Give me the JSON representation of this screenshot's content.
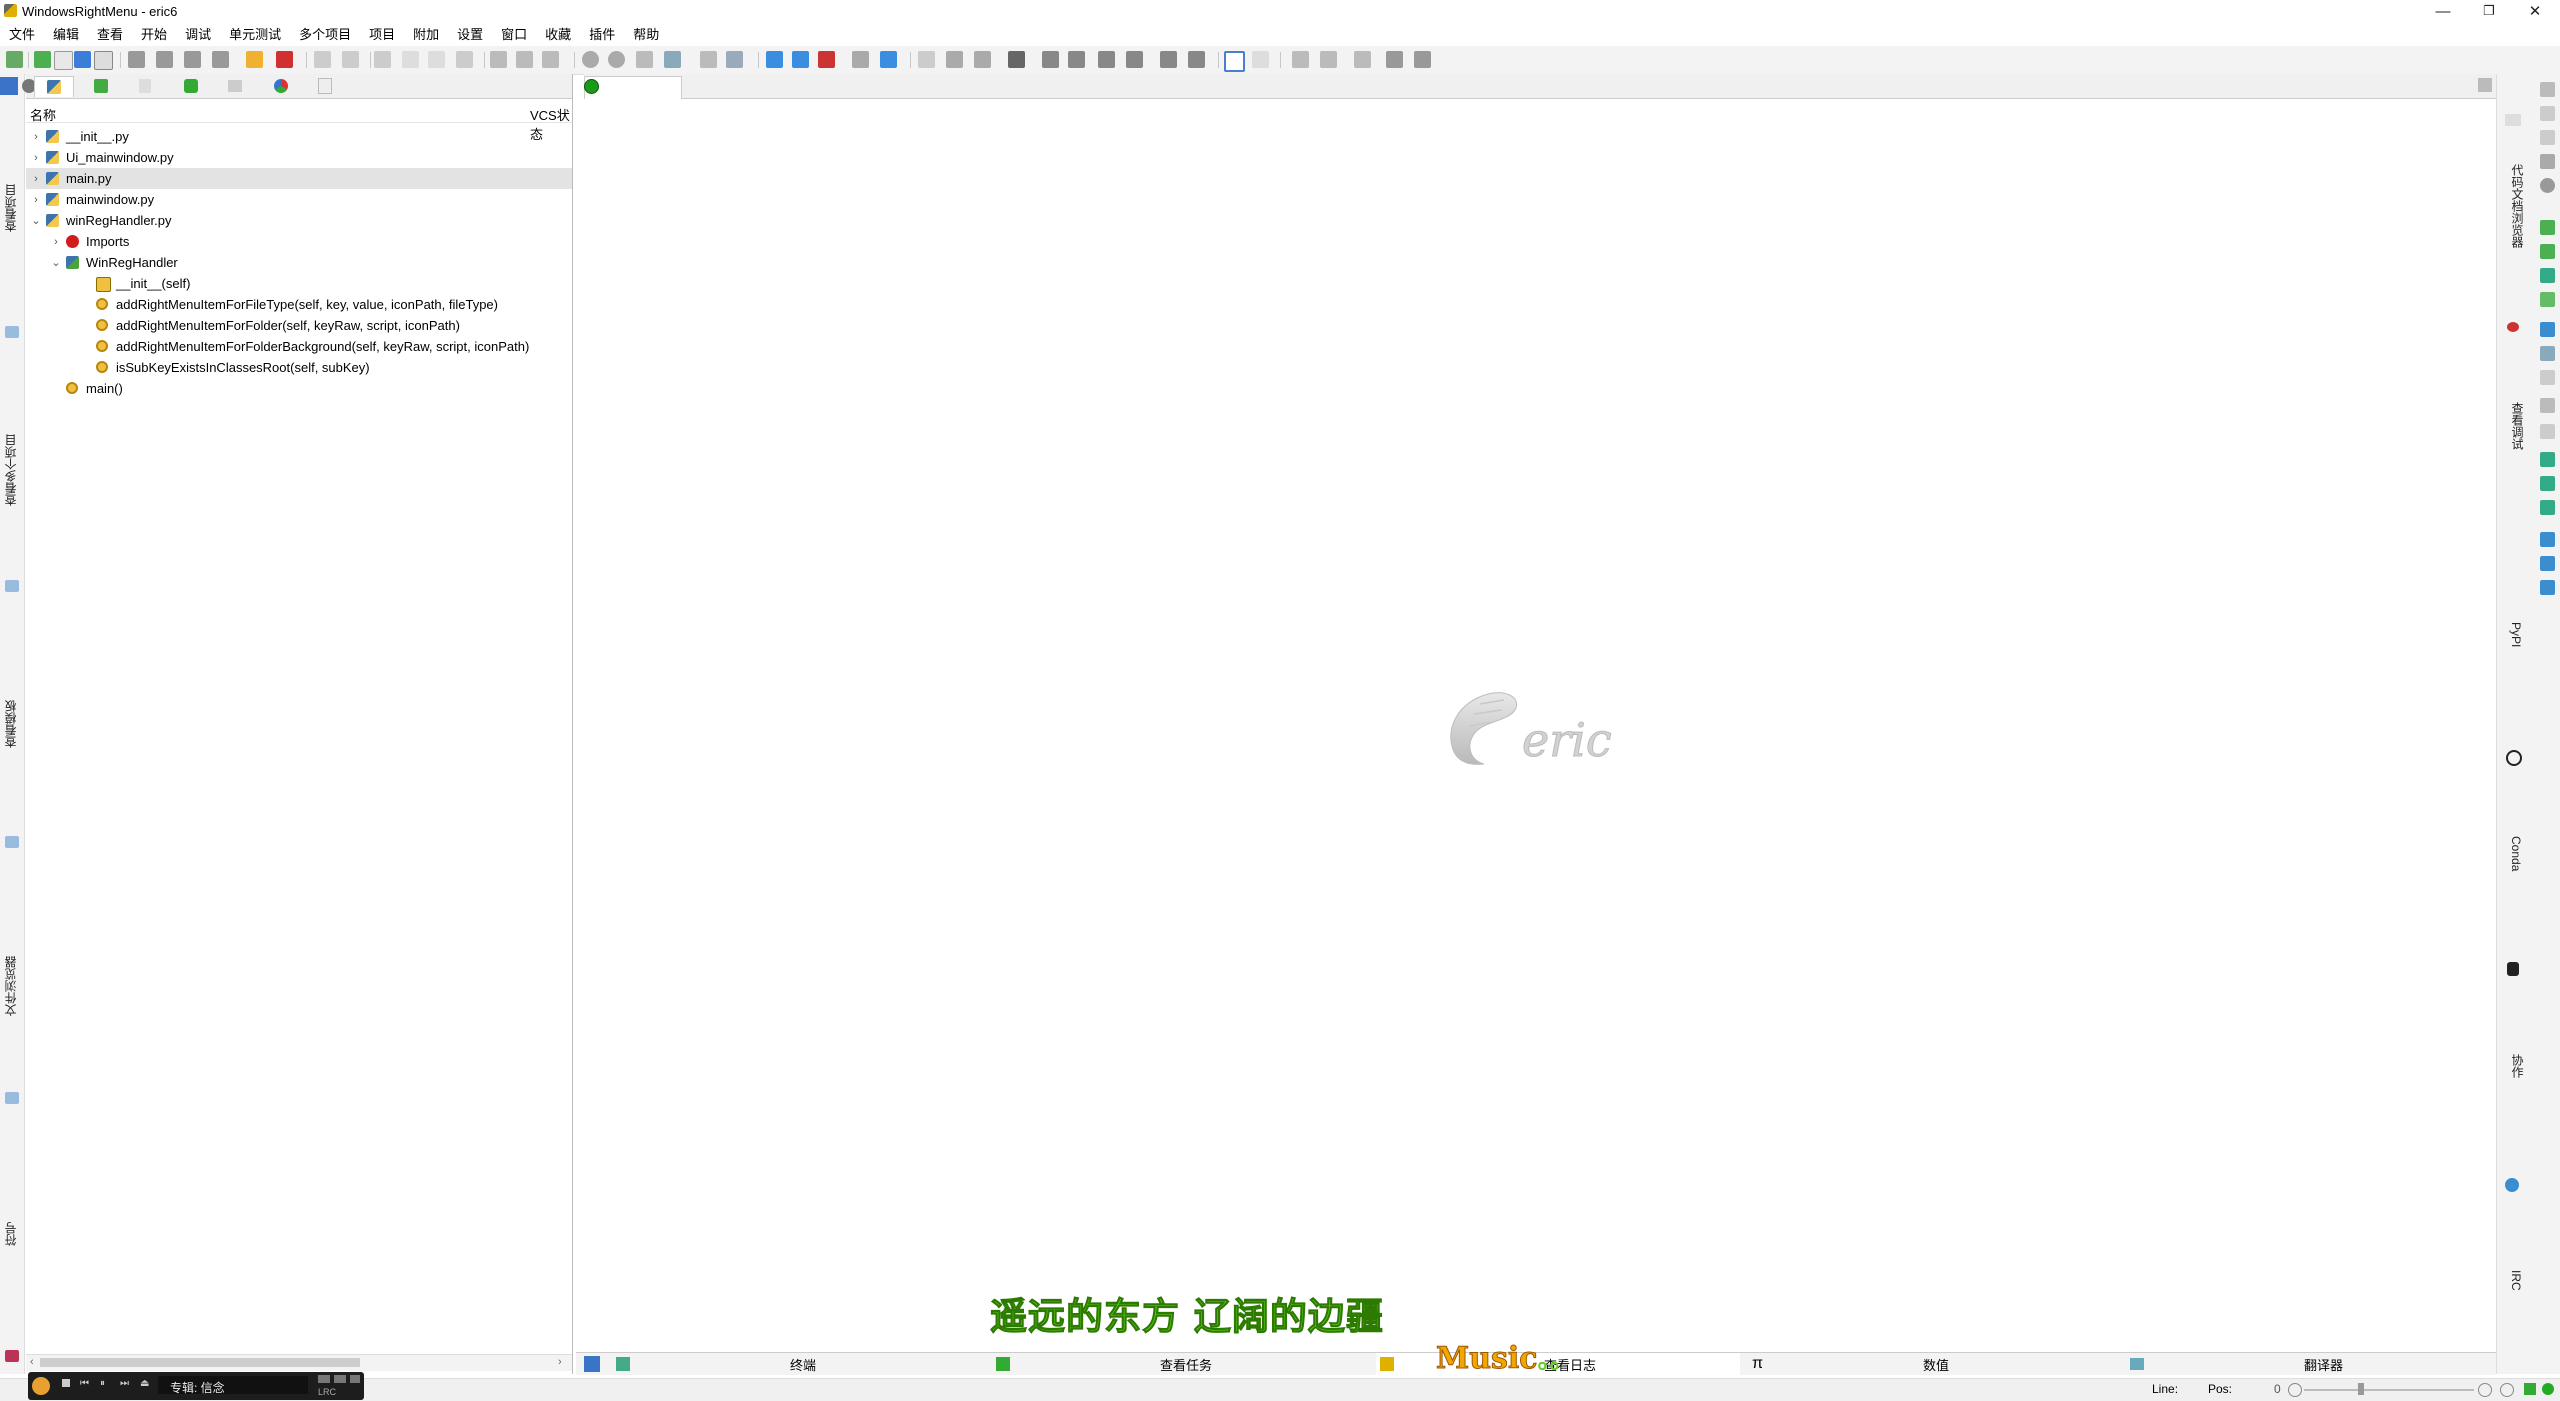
{
  "window": {
    "title": "WindowsRightMenu - eric6",
    "minimize_icon": "—",
    "restore_icon": "❐",
    "close_icon": "✕"
  },
  "menu": [
    "文件",
    "编辑",
    "查看",
    "开始",
    "调试",
    "单元测试",
    "多个项目",
    "项目",
    "附加",
    "设置",
    "窗口",
    "收藏",
    "插件",
    "帮助"
  ],
  "left_strip": {
    "labels": [
      "查看项目",
      "查看多个项目",
      "查看模板",
      "文件浏览器",
      "符号"
    ]
  },
  "project_panel": {
    "columns": {
      "name": "名称",
      "vcs": "VCS状态"
    },
    "tree": [
      {
        "label": "__init__.py",
        "level": 0,
        "arrow": "›",
        "icon": "python-file-icon"
      },
      {
        "label": "Ui_mainwindow.py",
        "level": 0,
        "arrow": "›",
        "icon": "python-file-icon"
      },
      {
        "label": "main.py",
        "level": 0,
        "arrow": "›",
        "icon": "python-file-icon",
        "selected": true
      },
      {
        "label": "mainwindow.py",
        "level": 0,
        "arrow": "›",
        "icon": "python-file-icon"
      },
      {
        "label": "winRegHandler.py",
        "level": 0,
        "arrow": "⌄",
        "icon": "python-file-icon"
      },
      {
        "label": "Imports",
        "level": 1,
        "arrow": "›",
        "icon": "imports-icon"
      },
      {
        "label": "WinRegHandler",
        "level": 1,
        "arrow": "⌄",
        "icon": "class-icon"
      },
      {
        "label": "__init__(self)",
        "level": 2,
        "arrow": "",
        "icon": "constructor-icon"
      },
      {
        "label": "addRightMenuItemForFileType(self, key, value, iconPath, fileType)",
        "level": 2,
        "arrow": "",
        "icon": "method-icon"
      },
      {
        "label": "addRightMenuItemForFolder(self, keyRaw, script, iconPath)",
        "level": 2,
        "arrow": "",
        "icon": "method-icon"
      },
      {
        "label": "addRightMenuItemForFolderBackground(self, keyRaw, script, iconPath)",
        "level": 2,
        "arrow": "",
        "icon": "method-icon"
      },
      {
        "label": "isSubKeyExistsInClassesRoot(self, subKey)",
        "level": 2,
        "arrow": "",
        "icon": "method-icon"
      },
      {
        "label": "main()",
        "level": 1,
        "arrow": "",
        "icon": "method-icon"
      }
    ]
  },
  "editor": {
    "logo_text": "eric"
  },
  "right_strip": {
    "labels": [
      "代码文档浏览器",
      "查看调试",
      "PyPI",
      "Conda",
      "协作",
      "IRC"
    ]
  },
  "bottom_dock": {
    "tabs": [
      "终端",
      "查看任务",
      "查看日志",
      "数值",
      "翻译器"
    ],
    "pi_symbol": "π"
  },
  "status": {
    "line_label": "Line:",
    "pos_label": "Pos:",
    "zoom_value": "0"
  },
  "overlay": {
    "lyrics": "遥远的东方 辽阔的边疆",
    "music": "Music",
    "music_suffix": "。。"
  },
  "player": {
    "album_text": "专辑: 信念",
    "lrc": "LRC"
  },
  "colors": {
    "accent_green": "#5fd11f",
    "music_orange": "#f0a800"
  }
}
